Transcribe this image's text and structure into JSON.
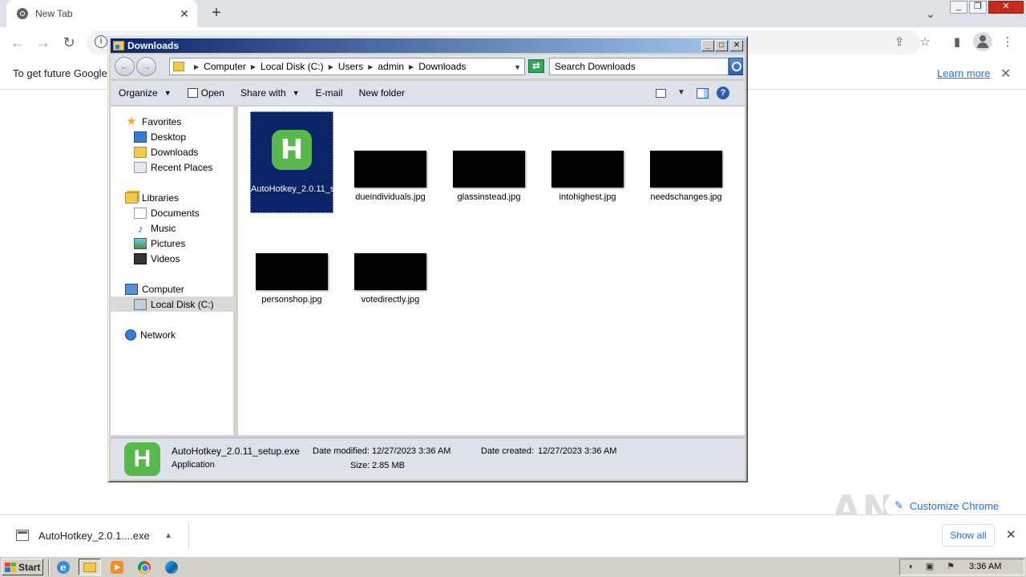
{
  "chrome": {
    "tab_title": "New Tab",
    "tab_close": "✕",
    "new_tab": "+",
    "tab_search": "⌄",
    "infobar_text": "To get future Google",
    "learn_more": "Learn more",
    "infobar_close": "✕",
    "customize_label": "Customize Chrome",
    "watermark": "ANY RUN"
  },
  "download_shelf": {
    "item_name": "AutoHotkey_2.0.1....exe",
    "show_all": "Show all",
    "close": "✕"
  },
  "explorer": {
    "title": "Downloads",
    "breadcrumb": [
      "Computer",
      "Local Disk (C:)",
      "Users",
      "admin",
      "Downloads"
    ],
    "search_placeholder": "Search Downloads",
    "toolbar": {
      "organize": "Organize",
      "open": "Open",
      "share_with": "Share with",
      "email": "E-mail",
      "new_folder": "New folder"
    },
    "nav": {
      "favorites": "Favorites",
      "desktop": "Desktop",
      "downloads": "Downloads",
      "recent_places": "Recent Places",
      "libraries": "Libraries",
      "documents": "Documents",
      "music": "Music",
      "pictures": "Pictures",
      "videos": "Videos",
      "computer": "Computer",
      "local_disk": "Local Disk (C:)",
      "network": "Network"
    },
    "files": [
      {
        "name": "AutoHotkey_2.0.11_setup.exe",
        "selected": true
      },
      {
        "name": "dueindividuals.jpg"
      },
      {
        "name": "glassinstead.jpg"
      },
      {
        "name": "intohighest.jpg"
      },
      {
        "name": "needschanges.jpg"
      },
      {
        "name": "personshop.jpg"
      },
      {
        "name": "votedirectly.jpg"
      }
    ],
    "details": {
      "name": "AutoHotkey_2.0.11_setup.exe",
      "type": "Application",
      "date_modified_label": "Date modified:",
      "date_modified": "12/27/2023 3:36 AM",
      "date_created_label": "Date created:",
      "date_created": "12/27/2023 3:36 AM",
      "size_label": "Size:",
      "size": "2.85 MB"
    }
  },
  "taskbar": {
    "start": "Start",
    "clock": "3:36 AM"
  }
}
